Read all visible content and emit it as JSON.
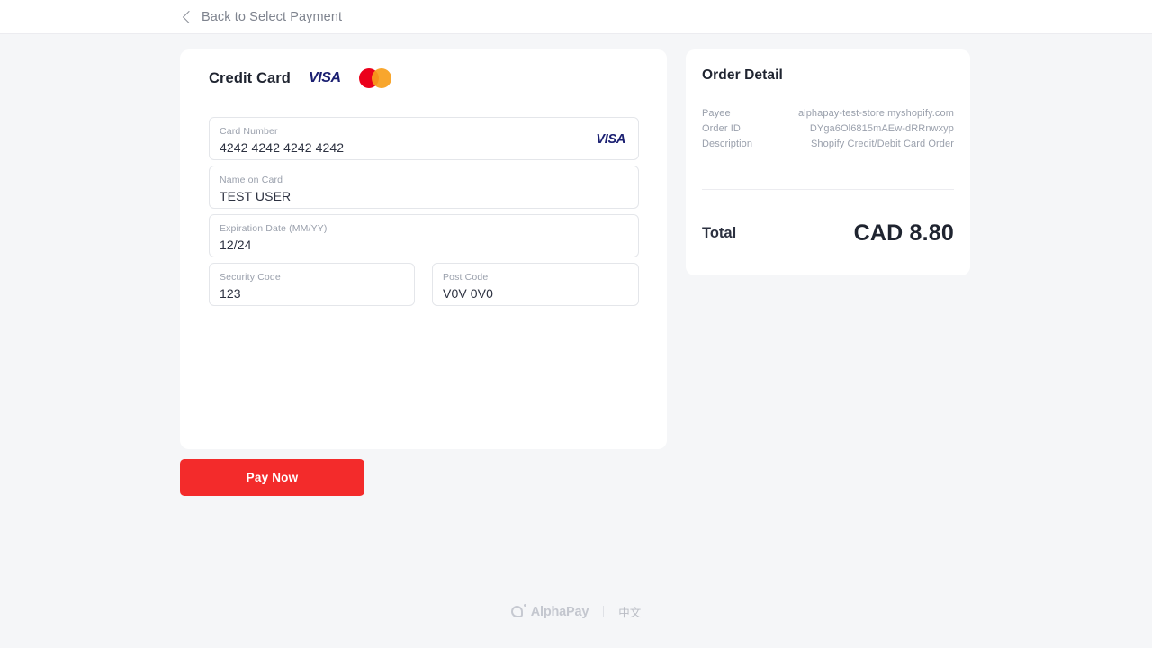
{
  "header": {
    "back_label": "Back to Select Payment",
    "back_icon": "chevron-left-icon"
  },
  "payment": {
    "title": "Credit Card",
    "brand_visa": "VISA",
    "brand_mastercard": "mastercard-logo",
    "fields": [
      {
        "key": "card_number",
        "label": "Card Number",
        "value": "4242 4242 4242 4242",
        "badge": "VISA"
      },
      {
        "key": "name_on_card",
        "label": "Name on Card",
        "value": "TEST USER"
      },
      {
        "key": "expiration",
        "label": "Expiration Date (MM/YY)",
        "value": "12/24"
      },
      {
        "key": "security_code",
        "label": "Security Code",
        "value": "123"
      },
      {
        "key": "post_code",
        "label": "Post Code",
        "value": "V0V 0V0"
      }
    ],
    "pay_button": "Pay Now"
  },
  "order": {
    "title": "Order Detail",
    "rows": [
      {
        "key": "Payee",
        "value": "alphapay-test-store.myshopify.com"
      },
      {
        "key": "Order ID",
        "value": "DYga6Ol6815mAEw-dRRnwxyp"
      },
      {
        "key": "Description",
        "value": "Shopify Credit/Debit Card Order"
      }
    ],
    "total_label": "Total",
    "total_value": "CAD 8.80"
  },
  "footer": {
    "brand": "AlphaPay",
    "brand_icon": "alphapay-logo-icon",
    "language_link": "中文"
  },
  "colors": {
    "accent_red": "#f32b2b",
    "visa_blue": "#1a1f71",
    "mastercard_red": "#eb001b",
    "mastercard_amber": "#f79e1b",
    "page_background": "#f5f6f8"
  }
}
